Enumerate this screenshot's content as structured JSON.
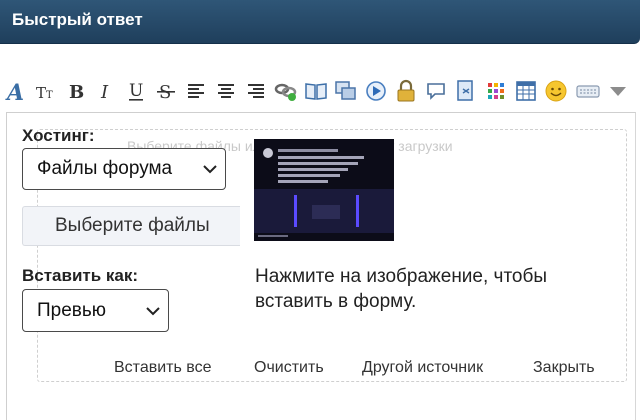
{
  "header": {
    "title": "Быстрый ответ"
  },
  "toolbar": {
    "icons": [
      "font-icon",
      "text-size-icon",
      "bold-icon",
      "italic-icon",
      "underline-icon",
      "strikethrough-icon",
      "align-left-icon",
      "align-center-icon",
      "align-right-icon",
      "link-icon",
      "book-icon",
      "gallery-icon",
      "media-play-icon",
      "lock-icon",
      "quote-bubble-icon",
      "code-icon",
      "color-palette-icon",
      "table-icon",
      "smiley-icon",
      "keyboard-icon",
      "more-arrow-icon"
    ]
  },
  "upload": {
    "drop_hint": "Выберите файлы или перетащите в зону загрузки",
    "hosting_label": "Хостинг:",
    "hosting_value": "Файлы форума",
    "choose_files": "Выберите файлы",
    "insert_as_label": "Вставить как:",
    "insert_as_value": "Превью",
    "click_hint": "Нажмите на изображение, чтобы вставить в форму."
  },
  "actions": {
    "insert_all": "Вставить все",
    "clear": "Очистить",
    "other_source": "Другой источник",
    "close": "Закрыть"
  },
  "colors": {
    "header_bg": "#264a6b",
    "header_text": "#ffffff",
    "font_icon": "#3a6ea5"
  }
}
